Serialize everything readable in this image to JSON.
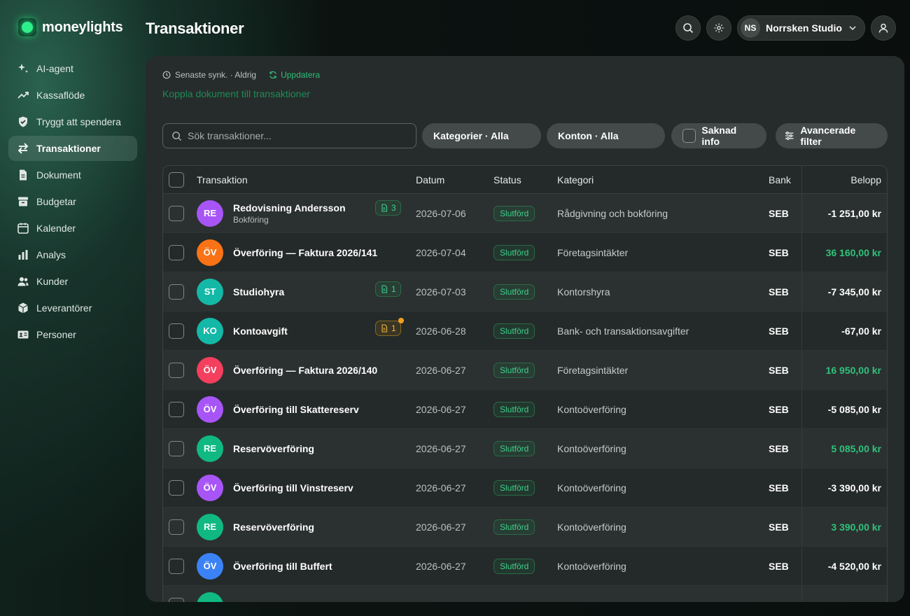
{
  "app": {
    "logo_text": "moneylights",
    "page_title": "Transaktioner"
  },
  "sidebar": {
    "items": [
      {
        "label": "AI-agent",
        "icon": "sparkle-icon",
        "active": false
      },
      {
        "label": "Kassaflöde",
        "icon": "trend-up-icon",
        "active": false
      },
      {
        "label": "Tryggt att spendera",
        "icon": "shield-icon",
        "active": false
      },
      {
        "label": "Transaktioner",
        "icon": "swap-arrows-icon",
        "active": true
      },
      {
        "label": "Dokument",
        "icon": "document-icon",
        "active": false
      },
      {
        "label": "Budgetar",
        "icon": "archive-box-icon",
        "active": false
      },
      {
        "label": "Kalender",
        "icon": "calendar-icon",
        "active": false
      },
      {
        "label": "Analys",
        "icon": "bar-chart-icon",
        "active": false
      },
      {
        "label": "Kunder",
        "icon": "users-icon",
        "active": false
      },
      {
        "label": "Leverantörer",
        "icon": "cube-icon",
        "active": false
      },
      {
        "label": "Personer",
        "icon": "id-card-icon",
        "active": false
      }
    ]
  },
  "header": {
    "org": {
      "initials": "NS",
      "name": "Norrsken Studio"
    }
  },
  "sync": {
    "status": "Senaste synk. · Aldrig",
    "refresh_label": "Uppdatera",
    "link_docs": "Koppla dokument till transaktioner"
  },
  "filters": {
    "search_placeholder": "Sök transaktioner...",
    "categories": "Kategorier · Alla",
    "accounts": "Konton · Alla",
    "missing_info": "Saknad info",
    "advanced": "Avancerade filter"
  },
  "table": {
    "columns": {
      "transaction": "Transaktion",
      "date": "Datum",
      "status": "Status",
      "category": "Kategori",
      "bank": "Bank",
      "amount": "Belopp"
    },
    "rows": [
      {
        "initials": "RE",
        "color": "#a855f7",
        "name": "Redovisning Andersson",
        "sub": "Bokföring",
        "badge": "3",
        "badge_type": "green",
        "date": "2026-07-06",
        "status": "Slutförd",
        "category": "Rådgivning och bokföring",
        "bank": "SEB",
        "amount": "-1 251,00 kr",
        "positive": false
      },
      {
        "initials": "ÖV",
        "color": "#f97316",
        "name": "Överföring — Faktura 2026/141",
        "sub": "",
        "badge": "",
        "badge_type": "",
        "date": "2026-07-04",
        "status": "Slutförd",
        "category": "Företagsintäkter",
        "bank": "SEB",
        "amount": "36 160,00 kr",
        "positive": true
      },
      {
        "initials": "ST",
        "color": "#14b8a6",
        "name": "Studiohyra",
        "sub": "",
        "badge": "1",
        "badge_type": "green",
        "date": "2026-07-03",
        "status": "Slutförd",
        "category": "Kontorshyra",
        "bank": "SEB",
        "amount": "-7 345,00 kr",
        "positive": false
      },
      {
        "initials": "KO",
        "color": "#14b8a6",
        "name": "Kontoavgift",
        "sub": "",
        "badge": "1",
        "badge_type": "amber",
        "date": "2026-06-28",
        "status": "Slutförd",
        "category": "Bank- och transaktionsavgifter",
        "bank": "SEB",
        "amount": "-67,00 kr",
        "positive": false
      },
      {
        "initials": "ÖV",
        "color": "#f43f5e",
        "name": "Överföring — Faktura 2026/140",
        "sub": "",
        "badge": "",
        "badge_type": "",
        "date": "2026-06-27",
        "status": "Slutförd",
        "category": "Företagsintäkter",
        "bank": "SEB",
        "amount": "16 950,00 kr",
        "positive": true
      },
      {
        "initials": "ÖV",
        "color": "#a855f7",
        "name": "Överföring till Skattereserv",
        "sub": "",
        "badge": "",
        "badge_type": "",
        "date": "2026-06-27",
        "status": "Slutförd",
        "category": "Kontoöverföring",
        "bank": "SEB",
        "amount": "-5 085,00 kr",
        "positive": false
      },
      {
        "initials": "RE",
        "color": "#10b981",
        "name": "Reservöverföring",
        "sub": "",
        "badge": "",
        "badge_type": "",
        "date": "2026-06-27",
        "status": "Slutförd",
        "category": "Kontoöverföring",
        "bank": "SEB",
        "amount": "5 085,00 kr",
        "positive": true
      },
      {
        "initials": "ÖV",
        "color": "#a855f7",
        "name": "Överföring till Vinstreserv",
        "sub": "",
        "badge": "",
        "badge_type": "",
        "date": "2026-06-27",
        "status": "Slutförd",
        "category": "Kontoöverföring",
        "bank": "SEB",
        "amount": "-3 390,00 kr",
        "positive": false
      },
      {
        "initials": "RE",
        "color": "#10b981",
        "name": "Reservöverföring",
        "sub": "",
        "badge": "",
        "badge_type": "",
        "date": "2026-06-27",
        "status": "Slutförd",
        "category": "Kontoöverföring",
        "bank": "SEB",
        "amount": "3 390,00 kr",
        "positive": true
      },
      {
        "initials": "ÖV",
        "color": "#3b82f6",
        "name": "Överföring till Buffert",
        "sub": "",
        "badge": "",
        "badge_type": "",
        "date": "2026-06-27",
        "status": "Slutförd",
        "category": "Kontoöverföring",
        "bank": "SEB",
        "amount": "-4 520,00 kr",
        "positive": false
      },
      {
        "initials": "",
        "color": "#10b981",
        "name": "",
        "sub": "",
        "badge": "",
        "badge_type": "",
        "date": "",
        "status": "",
        "category": "",
        "bank": "",
        "amount": "",
        "positive": false
      }
    ]
  }
}
